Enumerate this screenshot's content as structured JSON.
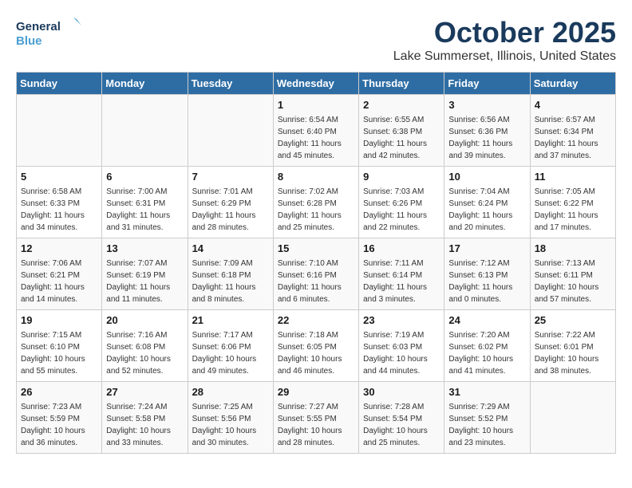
{
  "header": {
    "logo_line1": "General",
    "logo_line2": "Blue",
    "month": "October 2025",
    "location": "Lake Summerset, Illinois, United States"
  },
  "days_of_week": [
    "Sunday",
    "Monday",
    "Tuesday",
    "Wednesday",
    "Thursday",
    "Friday",
    "Saturday"
  ],
  "weeks": [
    [
      {
        "day": "",
        "info": ""
      },
      {
        "day": "",
        "info": ""
      },
      {
        "day": "",
        "info": ""
      },
      {
        "day": "1",
        "info": "Sunrise: 6:54 AM\nSunset: 6:40 PM\nDaylight: 11 hours\nand 45 minutes."
      },
      {
        "day": "2",
        "info": "Sunrise: 6:55 AM\nSunset: 6:38 PM\nDaylight: 11 hours\nand 42 minutes."
      },
      {
        "day": "3",
        "info": "Sunrise: 6:56 AM\nSunset: 6:36 PM\nDaylight: 11 hours\nand 39 minutes."
      },
      {
        "day": "4",
        "info": "Sunrise: 6:57 AM\nSunset: 6:34 PM\nDaylight: 11 hours\nand 37 minutes."
      }
    ],
    [
      {
        "day": "5",
        "info": "Sunrise: 6:58 AM\nSunset: 6:33 PM\nDaylight: 11 hours\nand 34 minutes."
      },
      {
        "day": "6",
        "info": "Sunrise: 7:00 AM\nSunset: 6:31 PM\nDaylight: 11 hours\nand 31 minutes."
      },
      {
        "day": "7",
        "info": "Sunrise: 7:01 AM\nSunset: 6:29 PM\nDaylight: 11 hours\nand 28 minutes."
      },
      {
        "day": "8",
        "info": "Sunrise: 7:02 AM\nSunset: 6:28 PM\nDaylight: 11 hours\nand 25 minutes."
      },
      {
        "day": "9",
        "info": "Sunrise: 7:03 AM\nSunset: 6:26 PM\nDaylight: 11 hours\nand 22 minutes."
      },
      {
        "day": "10",
        "info": "Sunrise: 7:04 AM\nSunset: 6:24 PM\nDaylight: 11 hours\nand 20 minutes."
      },
      {
        "day": "11",
        "info": "Sunrise: 7:05 AM\nSunset: 6:22 PM\nDaylight: 11 hours\nand 17 minutes."
      }
    ],
    [
      {
        "day": "12",
        "info": "Sunrise: 7:06 AM\nSunset: 6:21 PM\nDaylight: 11 hours\nand 14 minutes."
      },
      {
        "day": "13",
        "info": "Sunrise: 7:07 AM\nSunset: 6:19 PM\nDaylight: 11 hours\nand 11 minutes."
      },
      {
        "day": "14",
        "info": "Sunrise: 7:09 AM\nSunset: 6:18 PM\nDaylight: 11 hours\nand 8 minutes."
      },
      {
        "day": "15",
        "info": "Sunrise: 7:10 AM\nSunset: 6:16 PM\nDaylight: 11 hours\nand 6 minutes."
      },
      {
        "day": "16",
        "info": "Sunrise: 7:11 AM\nSunset: 6:14 PM\nDaylight: 11 hours\nand 3 minutes."
      },
      {
        "day": "17",
        "info": "Sunrise: 7:12 AM\nSunset: 6:13 PM\nDaylight: 11 hours\nand 0 minutes."
      },
      {
        "day": "18",
        "info": "Sunrise: 7:13 AM\nSunset: 6:11 PM\nDaylight: 10 hours\nand 57 minutes."
      }
    ],
    [
      {
        "day": "19",
        "info": "Sunrise: 7:15 AM\nSunset: 6:10 PM\nDaylight: 10 hours\nand 55 minutes."
      },
      {
        "day": "20",
        "info": "Sunrise: 7:16 AM\nSunset: 6:08 PM\nDaylight: 10 hours\nand 52 minutes."
      },
      {
        "day": "21",
        "info": "Sunrise: 7:17 AM\nSunset: 6:06 PM\nDaylight: 10 hours\nand 49 minutes."
      },
      {
        "day": "22",
        "info": "Sunrise: 7:18 AM\nSunset: 6:05 PM\nDaylight: 10 hours\nand 46 minutes."
      },
      {
        "day": "23",
        "info": "Sunrise: 7:19 AM\nSunset: 6:03 PM\nDaylight: 10 hours\nand 44 minutes."
      },
      {
        "day": "24",
        "info": "Sunrise: 7:20 AM\nSunset: 6:02 PM\nDaylight: 10 hours\nand 41 minutes."
      },
      {
        "day": "25",
        "info": "Sunrise: 7:22 AM\nSunset: 6:01 PM\nDaylight: 10 hours\nand 38 minutes."
      }
    ],
    [
      {
        "day": "26",
        "info": "Sunrise: 7:23 AM\nSunset: 5:59 PM\nDaylight: 10 hours\nand 36 minutes."
      },
      {
        "day": "27",
        "info": "Sunrise: 7:24 AM\nSunset: 5:58 PM\nDaylight: 10 hours\nand 33 minutes."
      },
      {
        "day": "28",
        "info": "Sunrise: 7:25 AM\nSunset: 5:56 PM\nDaylight: 10 hours\nand 30 minutes."
      },
      {
        "day": "29",
        "info": "Sunrise: 7:27 AM\nSunset: 5:55 PM\nDaylight: 10 hours\nand 28 minutes."
      },
      {
        "day": "30",
        "info": "Sunrise: 7:28 AM\nSunset: 5:54 PM\nDaylight: 10 hours\nand 25 minutes."
      },
      {
        "day": "31",
        "info": "Sunrise: 7:29 AM\nSunset: 5:52 PM\nDaylight: 10 hours\nand 23 minutes."
      },
      {
        "day": "",
        "info": ""
      }
    ]
  ]
}
